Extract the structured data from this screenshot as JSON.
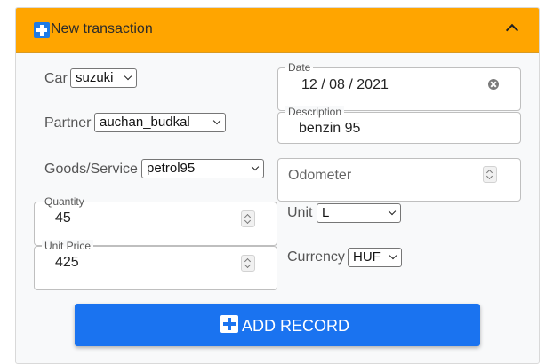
{
  "panel": {
    "title": "New transaction",
    "collapse_icon": "chevron-up-icon"
  },
  "form": {
    "car": {
      "label": "Car",
      "value": "suzuki"
    },
    "partner": {
      "label": "Partner",
      "value": "auchan_budkal"
    },
    "goods": {
      "label": "Goods/Service",
      "value": "petrol95"
    },
    "quantity": {
      "label": "Quantity",
      "value": "45"
    },
    "unit_price": {
      "label": "Unit Price",
      "value": "425"
    },
    "date": {
      "label": "Date",
      "value": "12 / 08 / 2021"
    },
    "description": {
      "label": "Description",
      "value": "benzin 95"
    },
    "odometer": {
      "placeholder": "Odometer"
    },
    "unit": {
      "label": "Unit",
      "value": "L"
    },
    "currency": {
      "label": "Currency",
      "value": "HUF"
    }
  },
  "submit": {
    "label": "ADD RECORD"
  },
  "colors": {
    "header": "#ffa500",
    "button": "#1a73f0",
    "icon": "#1e7be6"
  }
}
